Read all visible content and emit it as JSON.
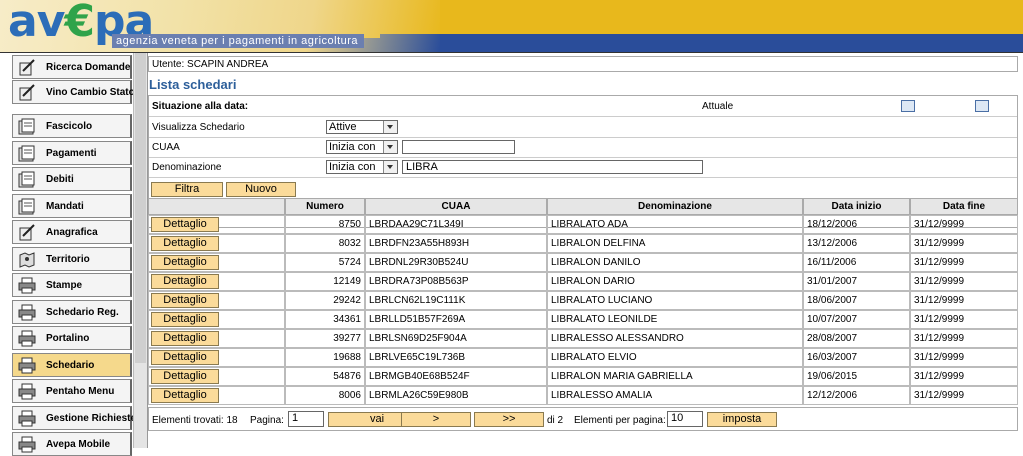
{
  "header": {
    "logo": {
      "part1": "av",
      "part2": "€",
      "part3": "pa"
    },
    "tagline": "agenzia veneta per i pagamenti in agricoltura"
  },
  "sidebar": {
    "top_items": [
      {
        "label": "Ricerca Domande",
        "icon": "pen-document-icon"
      },
      {
        "label": "Vino Cambio Stato",
        "icon": "pen-document-icon"
      }
    ],
    "items": [
      {
        "label": "Fascicolo",
        "icon": "folder-icon"
      },
      {
        "label": "Pagamenti",
        "icon": "folder-icon"
      },
      {
        "label": "Debiti",
        "icon": "folder-icon"
      },
      {
        "label": "Mandati",
        "icon": "folder-icon"
      },
      {
        "label": "Anagrafica",
        "icon": "pen-document-icon"
      },
      {
        "label": "Territorio",
        "icon": "map-icon"
      },
      {
        "label": "Stampe",
        "icon": "printer-icon"
      },
      {
        "label": "Schedario Reg.",
        "icon": "printer-icon"
      },
      {
        "label": "Portalino",
        "icon": "printer-icon"
      },
      {
        "label": "Schedario",
        "icon": "printer-icon",
        "active": true
      },
      {
        "label": "Pentaho Menu",
        "icon": "printer-icon"
      },
      {
        "label": "Gestione Richieste",
        "icon": "printer-icon"
      },
      {
        "label": "Avepa Mobile",
        "icon": "printer-icon"
      }
    ]
  },
  "main": {
    "user": "Utente: SCAPIN ANDREA",
    "title": "Lista schedari",
    "filters": {
      "situation_label": "Situazione alla data:",
      "situation_value": "Attuale",
      "schedario_label": "Visualizza Schedario",
      "schedario_value": "Attive",
      "cuaa_label": "CUAA",
      "cuaa_mode": "Inizia con",
      "cuaa_value": "",
      "denom_label": "Denominazione",
      "denom_mode": "Inizia con",
      "denom_value": "LIBRA",
      "filter_button": "Filtra",
      "new_button": "Nuovo"
    },
    "table": {
      "headers": [
        "",
        "Numero",
        "CUAA",
        "Denominazione",
        "Data inizio",
        "Data fine"
      ],
      "detail_label": "Dettaglio",
      "rows": [
        [
          "8750",
          "LBRDAA29C71L349I",
          "LIBRALATO ADA",
          "18/12/2006",
          "31/12/9999"
        ],
        [
          "8032",
          "LBRDFN23A55H893H",
          "LIBRALON DELFINA",
          "13/12/2006",
          "31/12/9999"
        ],
        [
          "5724",
          "LBRDNL29R30B524U",
          "LIBRALON DANILO",
          "16/11/2006",
          "31/12/9999"
        ],
        [
          "12149",
          "LBRDRA73P08B563P",
          "LIBRALON DARIO",
          "31/01/2007",
          "31/12/9999"
        ],
        [
          "29242",
          "LBRLCN62L19C111K",
          "LIBRALATO LUCIANO",
          "18/06/2007",
          "31/12/9999"
        ],
        [
          "34361",
          "LBRLLD51B57F269A",
          "LIBRALATO LEONILDE",
          "10/07/2007",
          "31/12/9999"
        ],
        [
          "39277",
          "LBRLSN69D25F904A",
          "LIBRALESSO ALESSANDRO",
          "28/08/2007",
          "31/12/9999"
        ],
        [
          "19688",
          "LBRLVE65C19L736B",
          "LIBRALATO ELVIO",
          "16/03/2007",
          "31/12/9999"
        ],
        [
          "54876",
          "LBRMGB40E68B524F",
          "LIBRALON MARIA GABRIELLA",
          "19/06/2015",
          "31/12/9999"
        ],
        [
          "8006",
          "LBRMLA26C59E980B",
          "LIBRALESSO AMALIA",
          "12/12/2006",
          "31/12/9999"
        ]
      ]
    },
    "footer": {
      "found_label": "Elementi trovati: 18",
      "page_label": "Pagina:",
      "page_value": "1",
      "go_button": "vai",
      "next_button": ">",
      "last_button": ">>",
      "of_label": "di 2",
      "per_page_label": "Elementi per pagina:",
      "per_page_value": "10",
      "set_button": "imposta"
    }
  }
}
